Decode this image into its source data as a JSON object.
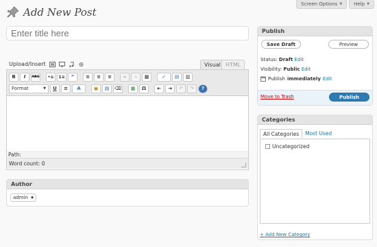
{
  "top_buttons": {
    "screen_options": "Screen Options",
    "help": "Help"
  },
  "page_title": "Add New Post",
  "title_input": {
    "placeholder": "Enter title here"
  },
  "upload": {
    "label": "Upload/Insert"
  },
  "editor_tabs": {
    "visual": "Visual",
    "html": "HTML"
  },
  "toolbar": {
    "row1": [
      "B",
      "I",
      "ABC",
      "•≡",
      "1≡",
      "“",
      "≡",
      "≡",
      "≡",
      "∞",
      "⌁",
      "▦",
      "✓",
      "▤",
      "▥"
    ],
    "format_label": "Format",
    "row2": [
      "U",
      "≡",
      "A",
      "▣",
      "▤",
      "⌫",
      "▦",
      "Ω",
      "⇤",
      "⇥",
      "↶",
      "↷",
      "?"
    ]
  },
  "editor": {
    "path_label": "Path:",
    "word_count": "Word count: 0"
  },
  "author": {
    "title": "Author",
    "value": "admin"
  },
  "publish": {
    "title": "Publish",
    "save_draft": "Save Draft",
    "preview": "Preview",
    "status_label": "Status:",
    "status_value": "Draft",
    "visibility_label": "Visibility:",
    "visibility_value": "Public",
    "publish_label": "Publish",
    "publish_value": "immediately",
    "edit": "Edit",
    "move_to_trash": "Move to Trash",
    "publish_button": "Publish"
  },
  "categories": {
    "title": "Categories",
    "tabs": [
      "All Categories",
      "Most Used"
    ],
    "items": [
      "Uncategorized"
    ],
    "add_link": "+ Add New Category"
  }
}
